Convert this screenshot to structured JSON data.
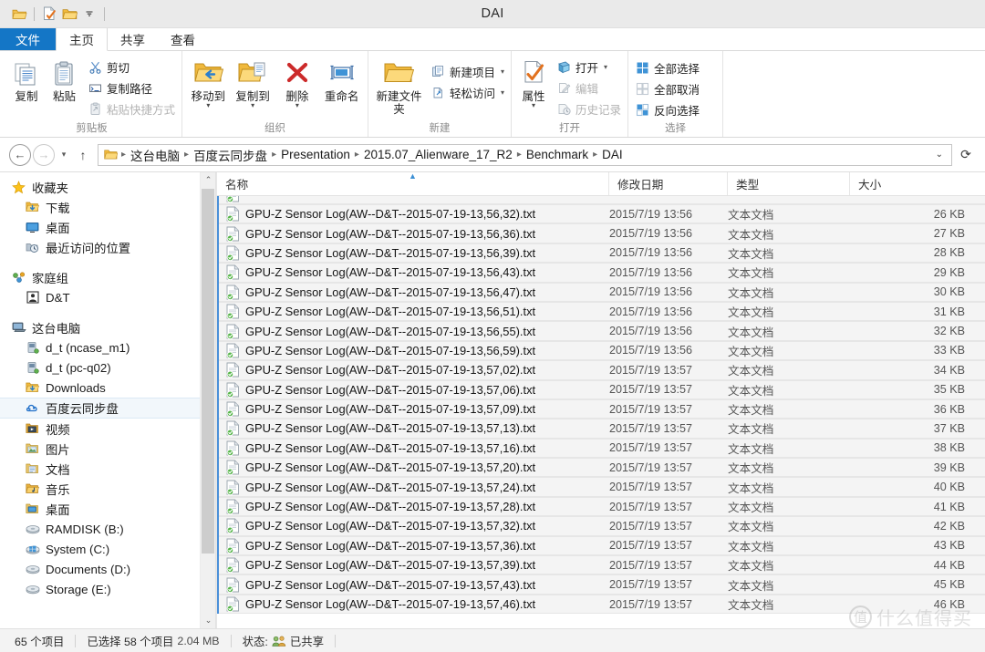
{
  "window": {
    "title": "DAI"
  },
  "quick_access": {
    "items": [
      {
        "name": "folder-icon",
        "label": "属性"
      },
      {
        "name": "new-folder-icon",
        "label": "新建文件夹"
      },
      {
        "name": "folder2-icon",
        "label": "文件夹"
      }
    ],
    "dropdown_label": "自定义快速访问工具栏"
  },
  "tabs": [
    {
      "id": "file",
      "label": "文件"
    },
    {
      "id": "home",
      "label": "主页"
    },
    {
      "id": "share",
      "label": "共享"
    },
    {
      "id": "view",
      "label": "查看"
    }
  ],
  "ribbon": {
    "groups": [
      {
        "id": "clipboard",
        "label": "剪贴板",
        "large": [
          {
            "label": "复制",
            "icon": "copy-icon",
            "dimmed": false
          },
          {
            "label": "粘贴",
            "icon": "paste-icon",
            "dimmed": false
          }
        ],
        "small": [
          {
            "label": "剪切",
            "icon": "scissors-icon",
            "dimmed": false
          },
          {
            "label": "复制路径",
            "icon": "copy-path-icon",
            "dimmed": false
          },
          {
            "label": "粘贴快捷方式",
            "icon": "paste-shortcut-icon",
            "dimmed": true
          }
        ]
      },
      {
        "id": "organize",
        "label": "组织",
        "large": [
          {
            "label": "移动到",
            "icon": "move-to-icon",
            "dropdown": true
          },
          {
            "label": "复制到",
            "icon": "copy-to-icon",
            "dropdown": true
          },
          {
            "label": "删除",
            "icon": "delete-icon",
            "dropdown": true
          },
          {
            "label": "重命名",
            "icon": "rename-icon",
            "dropdown": false
          }
        ]
      },
      {
        "id": "new",
        "label": "新建",
        "large": [
          {
            "label": "新建文件夹",
            "icon": "new-folder-icon",
            "dropdown": false
          }
        ],
        "small": [
          {
            "label": "新建项目",
            "icon": "new-item-icon",
            "dropdown": true
          },
          {
            "label": "轻松访问",
            "icon": "easy-access-icon",
            "dropdown": true
          }
        ]
      },
      {
        "id": "open",
        "label": "打开",
        "large": [
          {
            "label": "属性",
            "icon": "properties-icon",
            "dropdown": true
          }
        ],
        "small": [
          {
            "label": "打开",
            "icon": "open-icon",
            "dropdown": true,
            "dimmed": false
          },
          {
            "label": "编辑",
            "icon": "edit-icon",
            "dimmed": true
          },
          {
            "label": "历史记录",
            "icon": "history-icon",
            "dimmed": true
          }
        ]
      },
      {
        "id": "select",
        "label": "选择",
        "small": [
          {
            "label": "全部选择",
            "icon": "select-all-icon",
            "dimmed": false
          },
          {
            "label": "全部取消",
            "icon": "select-none-icon",
            "dimmed": true
          },
          {
            "label": "反向选择",
            "icon": "invert-selection-icon",
            "dimmed": false
          }
        ]
      }
    ]
  },
  "address": {
    "back_label": "后退",
    "forward_label": "前进",
    "recent_label": "最近浏览的位置",
    "up_label": "上移到",
    "refresh_label": "刷新",
    "dropdown_label": "以前的位置",
    "breadcrumbs": [
      "这台电脑",
      "百度云同步盘",
      "Presentation",
      "2015.07_Alienware_17_R2",
      "Benchmark",
      "DAI"
    ]
  },
  "sidebar": {
    "groups": [
      {
        "header": {
          "label": "收藏夹",
          "icon": "star-icon"
        },
        "items": [
          {
            "label": "下载",
            "icon": "downloads-icon"
          },
          {
            "label": "桌面",
            "icon": "desktop-icon"
          },
          {
            "label": "最近访问的位置",
            "icon": "recent-places-icon"
          }
        ]
      },
      {
        "header": {
          "label": "家庭组",
          "icon": "homegroup-icon"
        },
        "items": [
          {
            "label": "D&T",
            "icon": "user-icon"
          }
        ]
      },
      {
        "header": {
          "label": "这台电脑",
          "icon": "computer-icon"
        },
        "items": [
          {
            "label": "d_t (ncase_m1)",
            "icon": "network-folder-icon"
          },
          {
            "label": "d_t (pc-q02)",
            "icon": "network-folder-icon"
          },
          {
            "label": "Downloads",
            "icon": "downloads-folder-icon"
          },
          {
            "label": "百度云同步盘",
            "icon": "baidu-cloud-icon",
            "selected": true
          },
          {
            "label": "视频",
            "icon": "videos-icon"
          },
          {
            "label": "图片",
            "icon": "pictures-icon"
          },
          {
            "label": "文档",
            "icon": "documents-icon"
          },
          {
            "label": "音乐",
            "icon": "music-icon"
          },
          {
            "label": "桌面",
            "icon": "desktop-folder-icon"
          },
          {
            "label": "RAMDISK (B:)",
            "icon": "drive-icon"
          },
          {
            "label": "System (C:)",
            "icon": "system-drive-icon"
          },
          {
            "label": "Documents (D:)",
            "icon": "drive-icon"
          },
          {
            "label": "Storage (E:)",
            "icon": "drive-icon"
          }
        ]
      }
    ]
  },
  "filelist": {
    "columns": [
      {
        "id": "name",
        "label": "名称",
        "sorted": true
      },
      {
        "id": "date",
        "label": "修改日期"
      },
      {
        "id": "type",
        "label": "类型"
      },
      {
        "id": "size",
        "label": "大小"
      }
    ],
    "rows": [
      {
        "name": "GPU-Z Sensor Log(AW--D&T--2015-07-19-13,56,32).txt",
        "date": "2015/7/19 13:56",
        "type": "文本文档",
        "size": "26 KB",
        "selected": true
      },
      {
        "name": "GPU-Z Sensor Log(AW--D&T--2015-07-19-13,56,36).txt",
        "date": "2015/7/19 13:56",
        "type": "文本文档",
        "size": "27 KB",
        "selected": true
      },
      {
        "name": "GPU-Z Sensor Log(AW--D&T--2015-07-19-13,56,39).txt",
        "date": "2015/7/19 13:56",
        "type": "文本文档",
        "size": "28 KB",
        "selected": true
      },
      {
        "name": "GPU-Z Sensor Log(AW--D&T--2015-07-19-13,56,43).txt",
        "date": "2015/7/19 13:56",
        "type": "文本文档",
        "size": "29 KB",
        "selected": true
      },
      {
        "name": "GPU-Z Sensor Log(AW--D&T--2015-07-19-13,56,47).txt",
        "date": "2015/7/19 13:56",
        "type": "文本文档",
        "size": "30 KB",
        "selected": true
      },
      {
        "name": "GPU-Z Sensor Log(AW--D&T--2015-07-19-13,56,51).txt",
        "date": "2015/7/19 13:56",
        "type": "文本文档",
        "size": "31 KB",
        "selected": true
      },
      {
        "name": "GPU-Z Sensor Log(AW--D&T--2015-07-19-13,56,55).txt",
        "date": "2015/7/19 13:56",
        "type": "文本文档",
        "size": "32 KB",
        "selected": true
      },
      {
        "name": "GPU-Z Sensor Log(AW--D&T--2015-07-19-13,56,59).txt",
        "date": "2015/7/19 13:56",
        "type": "文本文档",
        "size": "33 KB",
        "selected": true
      },
      {
        "name": "GPU-Z Sensor Log(AW--D&T--2015-07-19-13,57,02).txt",
        "date": "2015/7/19 13:57",
        "type": "文本文档",
        "size": "34 KB",
        "selected": true
      },
      {
        "name": "GPU-Z Sensor Log(AW--D&T--2015-07-19-13,57,06).txt",
        "date": "2015/7/19 13:57",
        "type": "文本文档",
        "size": "35 KB",
        "selected": true
      },
      {
        "name": "GPU-Z Sensor Log(AW--D&T--2015-07-19-13,57,09).txt",
        "date": "2015/7/19 13:57",
        "type": "文本文档",
        "size": "36 KB",
        "selected": true
      },
      {
        "name": "GPU-Z Sensor Log(AW--D&T--2015-07-19-13,57,13).txt",
        "date": "2015/7/19 13:57",
        "type": "文本文档",
        "size": "37 KB",
        "selected": true
      },
      {
        "name": "GPU-Z Sensor Log(AW--D&T--2015-07-19-13,57,16).txt",
        "date": "2015/7/19 13:57",
        "type": "文本文档",
        "size": "38 KB",
        "selected": true
      },
      {
        "name": "GPU-Z Sensor Log(AW--D&T--2015-07-19-13,57,20).txt",
        "date": "2015/7/19 13:57",
        "type": "文本文档",
        "size": "39 KB",
        "selected": true
      },
      {
        "name": "GPU-Z Sensor Log(AW--D&T--2015-07-19-13,57,24).txt",
        "date": "2015/7/19 13:57",
        "type": "文本文档",
        "size": "40 KB",
        "selected": true
      },
      {
        "name": "GPU-Z Sensor Log(AW--D&T--2015-07-19-13,57,28).txt",
        "date": "2015/7/19 13:57",
        "type": "文本文档",
        "size": "41 KB",
        "selected": true
      },
      {
        "name": "GPU-Z Sensor Log(AW--D&T--2015-07-19-13,57,32).txt",
        "date": "2015/7/19 13:57",
        "type": "文本文档",
        "size": "42 KB",
        "selected": true
      },
      {
        "name": "GPU-Z Sensor Log(AW--D&T--2015-07-19-13,57,36).txt",
        "date": "2015/7/19 13:57",
        "type": "文本文档",
        "size": "43 KB",
        "selected": true
      },
      {
        "name": "GPU-Z Sensor Log(AW--D&T--2015-07-19-13,57,39).txt",
        "date": "2015/7/19 13:57",
        "type": "文本文档",
        "size": "44 KB",
        "selected": true
      },
      {
        "name": "GPU-Z Sensor Log(AW--D&T--2015-07-19-13,57,43).txt",
        "date": "2015/7/19 13:57",
        "type": "文本文档",
        "size": "45 KB",
        "selected": true
      },
      {
        "name": "GPU-Z Sensor Log(AW--D&T--2015-07-19-13,57,46).txt",
        "date": "2015/7/19 13:57",
        "type": "文本文档",
        "size": "46 KB",
        "selected": true
      }
    ]
  },
  "statusbar": {
    "item_count": "65 个项目",
    "selection_count": "已选择 58 个项目",
    "selection_size": "2.04 MB",
    "status_label": "状态:",
    "shared_label": "已共享"
  },
  "watermark": {
    "mark": "值",
    "text": "什么值得买"
  },
  "colors": {
    "accent": "#1476c6",
    "selection_bar": "#4a90d9",
    "folder": "#f5c243",
    "sort_arrow": "#3b8fd4"
  }
}
